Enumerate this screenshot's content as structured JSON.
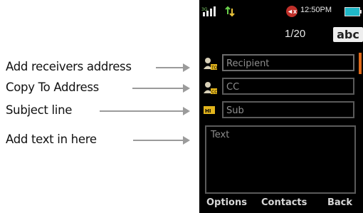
{
  "annotations": {
    "recipient": "Add receivers address",
    "cc": "Copy To Address",
    "subject": "Subject line",
    "text": "Add text in here"
  },
  "status": {
    "time": "12:50PM",
    "mute_label": "◄x"
  },
  "header": {
    "counter": "1/20",
    "input_mode": "abc"
  },
  "fields": {
    "recipient_placeholder": "Recipient",
    "cc_placeholder": "CC",
    "subject_placeholder": "Sub",
    "text_placeholder": "Text"
  },
  "softkeys": {
    "left": "Options",
    "center": "Contacts",
    "right": "Back"
  },
  "icons": {
    "recipient": "contact-to-icon",
    "cc": "contact-cc-icon",
    "subject": "subject-tag-icon",
    "signal": "signal-strength-icon",
    "data": "data-transfer-icon",
    "mute": "mute-icon",
    "battery": "battery-icon"
  },
  "colors": {
    "screen_bg": "#000000",
    "field_border": "#5a5a5a",
    "scroll_accent": "#e06a1a",
    "battery": "#1fb8c8",
    "mute": "#c0302a"
  }
}
